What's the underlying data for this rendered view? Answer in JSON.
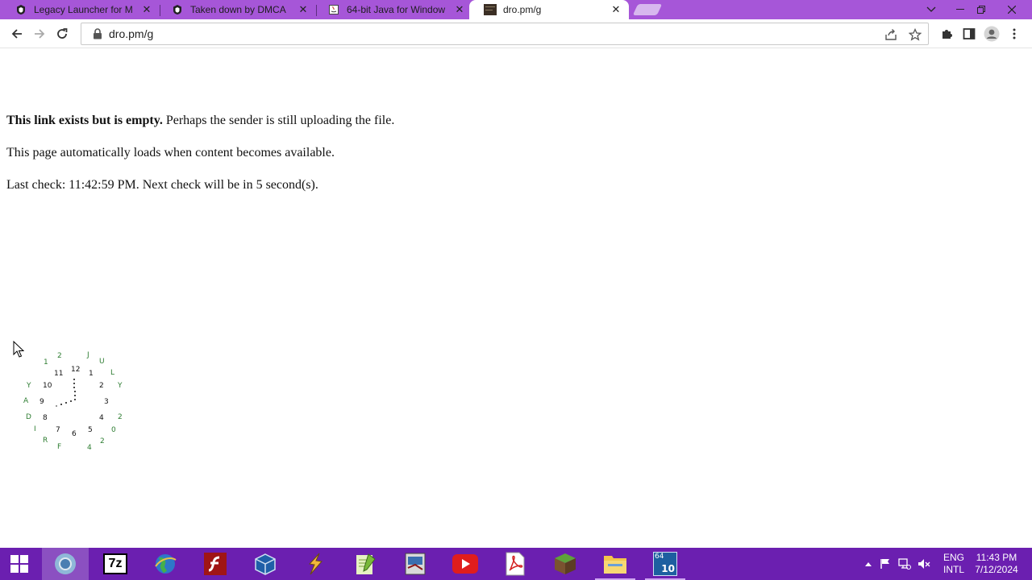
{
  "browser": {
    "tabs": [
      {
        "title": "Legacy Launcher for M",
        "favicon": "shield-icon",
        "active": false
      },
      {
        "title": "Taken down by DMCA",
        "favicon": "shield-icon",
        "active": false
      },
      {
        "title": "64-bit Java for Window",
        "favicon": "java-icon",
        "active": false
      },
      {
        "title": "dro.pm/g",
        "favicon": "dropm-icon",
        "active": true
      }
    ],
    "url": "dro.pm/g",
    "accent_color": "#a656d8"
  },
  "page": {
    "line1_bold": "This link exists but is empty.",
    "line1_rest": " Perhaps the sender is still uploading the file.",
    "line2": "This page automatically loads when content becomes available.",
    "line3": "Last check: 11:42:59 PM. Next check will be in 5 second(s)."
  },
  "clock_widget": {
    "hours": [
      "12",
      "1",
      "2",
      "3",
      "4",
      "5",
      "6",
      "7",
      "8",
      "9",
      "10",
      "11"
    ],
    "day_letters": [
      "F",
      "R",
      "I",
      "D",
      "A",
      "Y"
    ],
    "month_letters": [
      "J",
      "U",
      "L",
      "Y"
    ],
    "date_digits": [
      "1",
      "2",
      "2",
      "0",
      "2",
      "4"
    ],
    "year_digits": [
      "2",
      "0",
      "2",
      "4"
    ]
  },
  "taskbar": {
    "apps": [
      {
        "name": "chrome-icon",
        "active": true
      },
      {
        "name": "7zip-icon",
        "label": "7z"
      },
      {
        "name": "earth-icon"
      },
      {
        "name": "flash-icon"
      },
      {
        "name": "virtualbox-icon"
      },
      {
        "name": "winamp-icon"
      },
      {
        "name": "notepadpp-icon"
      },
      {
        "name": "photo-editor-icon"
      },
      {
        "name": "youtube-icon"
      },
      {
        "name": "pdf-icon"
      },
      {
        "name": "minecraft-icon"
      },
      {
        "name": "file-explorer-icon",
        "open": true
      },
      {
        "name": "java-setup-icon",
        "label": "10",
        "badge": "64",
        "open": true
      }
    ],
    "language_top": "ENG",
    "language_bottom": "INTL",
    "time": "11:43 PM",
    "date": "7/12/2024"
  }
}
